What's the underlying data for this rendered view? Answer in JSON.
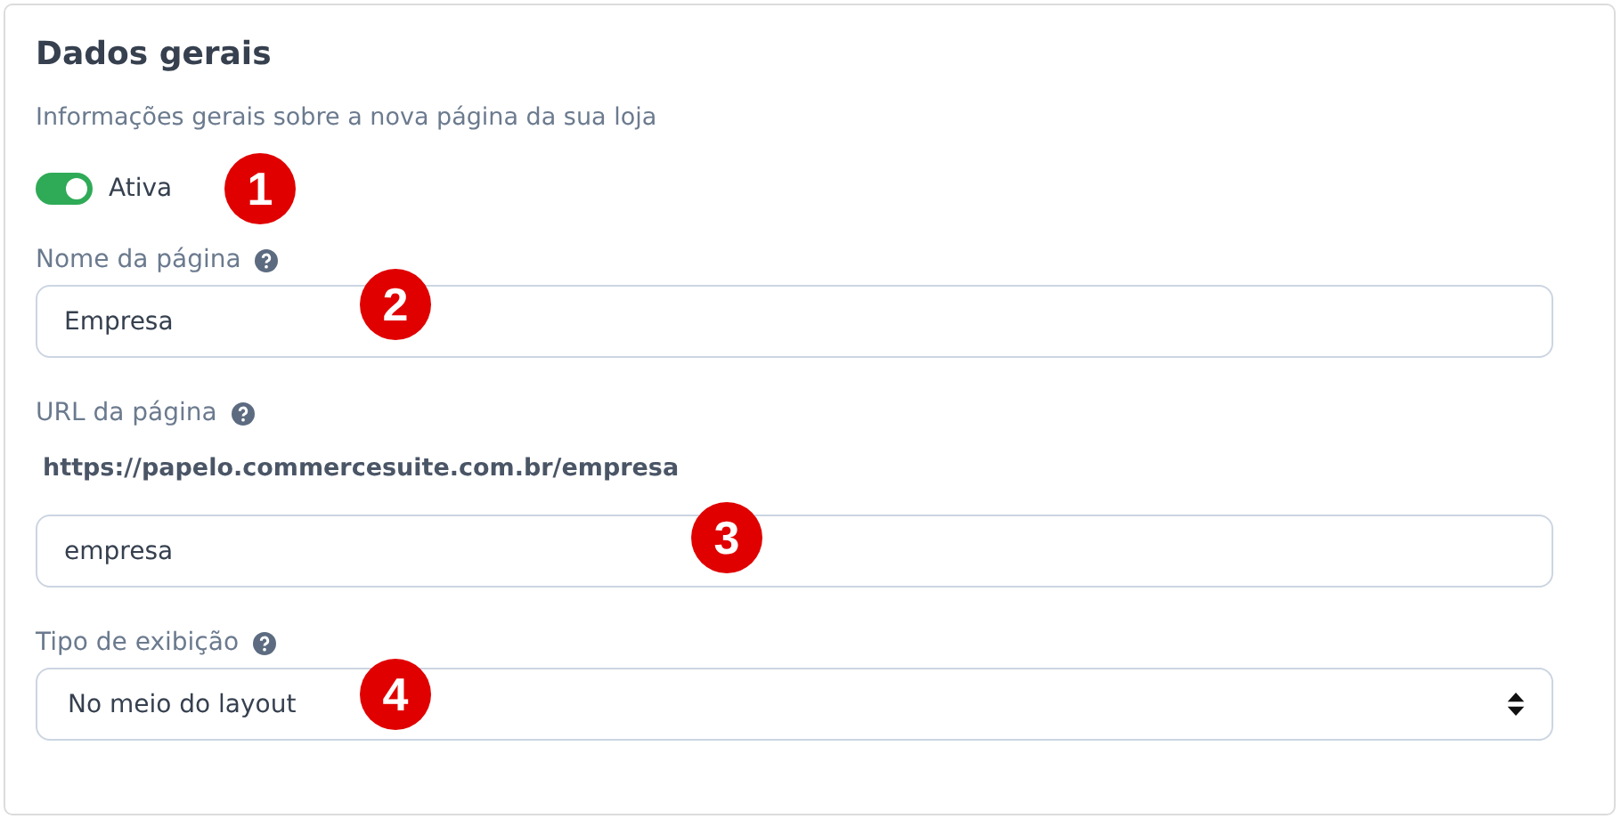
{
  "card": {
    "title": "Dados gerais",
    "subtitle": "Informações gerais sobre a nova página da sua loja"
  },
  "toggle": {
    "label": "Ativa",
    "on": true
  },
  "fields": [
    {
      "kind": "input",
      "label": "Nome da página",
      "help": true,
      "value": "Empresa"
    },
    {
      "kind": "input",
      "label": "URL da página",
      "help": true,
      "url": "https://papelo.commercesuite.com.br/empresa",
      "value": "empresa"
    },
    {
      "kind": "select",
      "label": "Tipo de exibição",
      "help": true,
      "value": "No meio do layout"
    }
  ],
  "callouts": [
    "1",
    "2",
    "3",
    "4"
  ]
}
